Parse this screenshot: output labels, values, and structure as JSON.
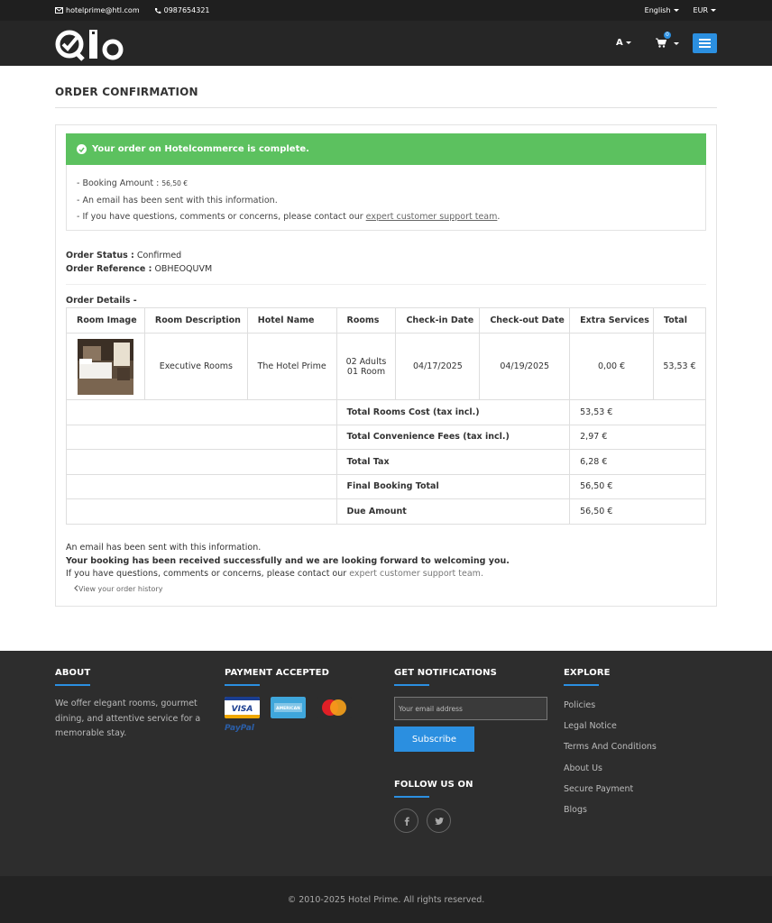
{
  "topbar": {
    "email": "hotelprime@htl.com",
    "phone": "0987654321",
    "language": "English",
    "currency": "EUR"
  },
  "header": {
    "user_initial": "A",
    "cart_count": "0"
  },
  "page": {
    "title": "ORDER CONFIRMATION"
  },
  "alert": {
    "message": "Your order on Hotelcommerce is complete.",
    "booking_amount_label": "- Booking Amount :",
    "booking_amount_value": "56,50 €",
    "email_sent": "- An email has been sent with this information.",
    "contact_prefix": "- If you have questions, comments or concerns, please contact our",
    "contact_link": "expert customer support team",
    "contact_suffix": "."
  },
  "order": {
    "status_label": "Order Status :",
    "status_value": "Confirmed",
    "reference_label": "Order Reference :",
    "reference_value": "OBHEOQUVM",
    "details_label": "Order Details -"
  },
  "table": {
    "headers": [
      "Room Image",
      "Room Description",
      "Hotel Name",
      "Rooms",
      "Check-in Date",
      "Check-out Date",
      "Extra Services",
      "Total"
    ],
    "row": {
      "description": "Executive Rooms",
      "hotel": "The Hotel Prime",
      "adults": "02 Adults",
      "rooms": "01 Room",
      "checkin": "04/17/2025",
      "checkout": "04/19/2025",
      "extra": "0,00 €",
      "total": "53,53 €"
    },
    "summary": [
      {
        "label": "Total Rooms Cost (tax incl.)",
        "value": "53,53 €"
      },
      {
        "label": "Total Convenience Fees (tax incl.)",
        "value": "2,97 €"
      },
      {
        "label": "Total Tax",
        "value": "6,28 €"
      },
      {
        "label": "Final Booking Total",
        "value": "56,50 €"
      },
      {
        "label": "Due Amount",
        "value": "56,50 €"
      }
    ]
  },
  "footnote": {
    "line1": "An email has been sent with this information.",
    "line2": "Your booking has been received successfully and we are looking forward to welcoming you.",
    "line3_prefix": "If you have questions, comments or concerns, please contact our",
    "line3_link": "expert customer support team.",
    "history": "View your order history"
  },
  "footer": {
    "about_title": "ABOUT",
    "about_text": "We offer elegant rooms, gourmet dining, and attentive service for a memorable stay.",
    "payment_title": "PAYMENT ACCEPTED",
    "paypal": "PayPal",
    "notify_title": "GET NOTIFICATIONS",
    "email_placeholder": "Your email address",
    "subscribe": "Subscribe",
    "follow_title": "FOLLOW US ON",
    "explore_title": "EXPLORE",
    "explore": [
      "Policies",
      "Legal Notice",
      "Terms And Conditions",
      "About Us",
      "Secure Payment",
      "Blogs"
    ],
    "copyright": "© 2010-2025  Hotel Prime.  All rights reserved."
  },
  "colors": {
    "accent": "#2b8fe0",
    "success": "#5cc15f",
    "dark": "#262626"
  }
}
